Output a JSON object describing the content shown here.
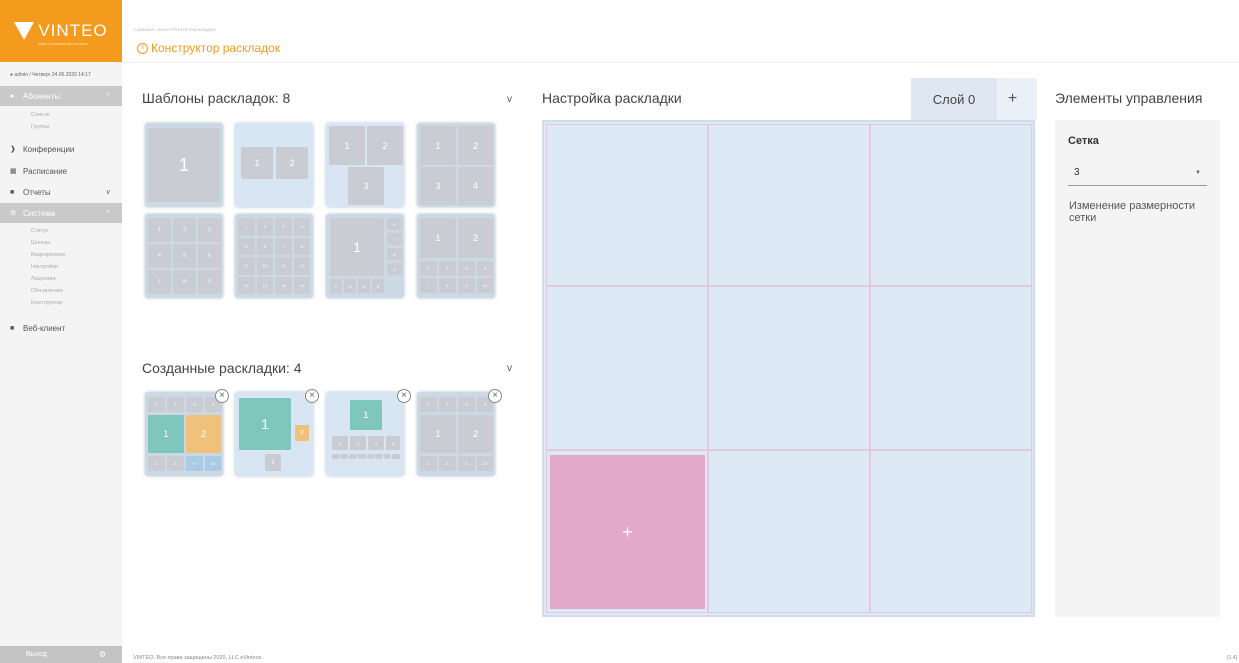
{
  "app": {
    "logo_text": "VINTEO",
    "logo_subtitle": "VIDEO CONFERENCING SYSTEMS",
    "user_line": "admin / Четверг 24.06.2020 14:17"
  },
  "sidebar": {
    "items": [
      {
        "label": "Абоненты",
        "active": true,
        "icon": "users-icon",
        "chevron": "^"
      },
      {
        "label": "Конференции",
        "active": false,
        "icon": "conference-icon"
      },
      {
        "label": "Расписание",
        "active": false,
        "icon": "calendar-icon"
      },
      {
        "label": "Отчеты",
        "active": false,
        "icon": "reports-icon",
        "chevron": "v"
      },
      {
        "label": "Система",
        "active": true,
        "icon": "settings-icon",
        "chevron": "^"
      },
      {
        "label": "Веб-клиент",
        "active": false,
        "icon": "camera-icon"
      }
    ],
    "subscribers_sub": [
      "Список",
      "Группы"
    ],
    "system_sub": [
      "Статус",
      "Шлюзы",
      "Видеоролики",
      "Настройки",
      "Лицензии",
      "Обновления",
      "Конструктор"
    ],
    "logout_label": "Выход"
  },
  "header": {
    "breadcrumb": "ГЛАВНАЯ / КОНСТРУКТОР РАСКЛАДОК",
    "title": "Конструктор раскладок"
  },
  "templates": {
    "title": "Шаблоны раскладок: 8",
    "chevron": "v"
  },
  "created": {
    "title": "Созданные раскладки: 4",
    "chevron": "v",
    "remove_label": "×"
  },
  "settings": {
    "title": "Настройка раскладки",
    "layer_tab": "Слой 0",
    "add_layer": "+",
    "add_cell": "+",
    "grid_size": 3
  },
  "controls": {
    "title": "Элементы управления",
    "grid_label": "Сетка",
    "grid_value": "3",
    "help_text": "Изменение размерности сетки"
  },
  "footer": {
    "copyright": "VINTEO. Все права защищены 2020, LLC eVinteos.",
    "version": "[1.4]"
  },
  "colors": {
    "accent": "#f49a1c",
    "canvas": "#dde9f5",
    "selected_cell": "#e2a9cb",
    "teal": "#7fc7bd",
    "orange": "#f0c17a"
  }
}
